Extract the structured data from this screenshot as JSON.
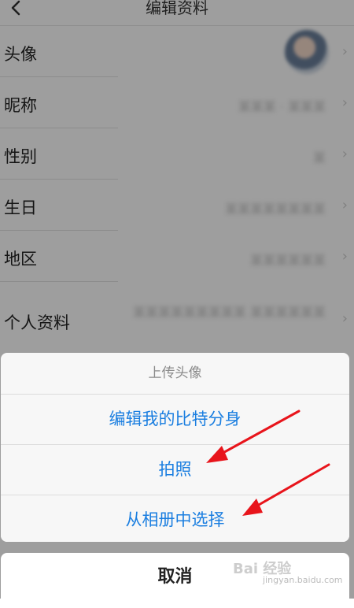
{
  "nav": {
    "title": "编辑资料",
    "back_icon": "chevron-left-icon"
  },
  "profile_rows": [
    {
      "label": "头像",
      "value": ""
    },
    {
      "label": "昵称",
      "value": "某某某 · 某某某"
    },
    {
      "label": "性别",
      "value": "某"
    },
    {
      "label": "生日",
      "value": "某某某某某某某某"
    },
    {
      "label": "地区",
      "value": "某某某某某某"
    },
    {
      "label": "个人资料",
      "value": "某某某某某某某某某 某某某某某某"
    }
  ],
  "action_sheet": {
    "header": "上传头像",
    "options": [
      {
        "label": "编辑我的比特分身"
      },
      {
        "label": "拍照"
      },
      {
        "label": "从相册中选择"
      }
    ],
    "cancel": "取消"
  },
  "colors": {
    "accent": "#1a7ee0",
    "annotation_arrow": "#e8141b"
  },
  "watermark": {
    "logo": "Bai 经验",
    "url": "jingyan.baidu.com"
  }
}
